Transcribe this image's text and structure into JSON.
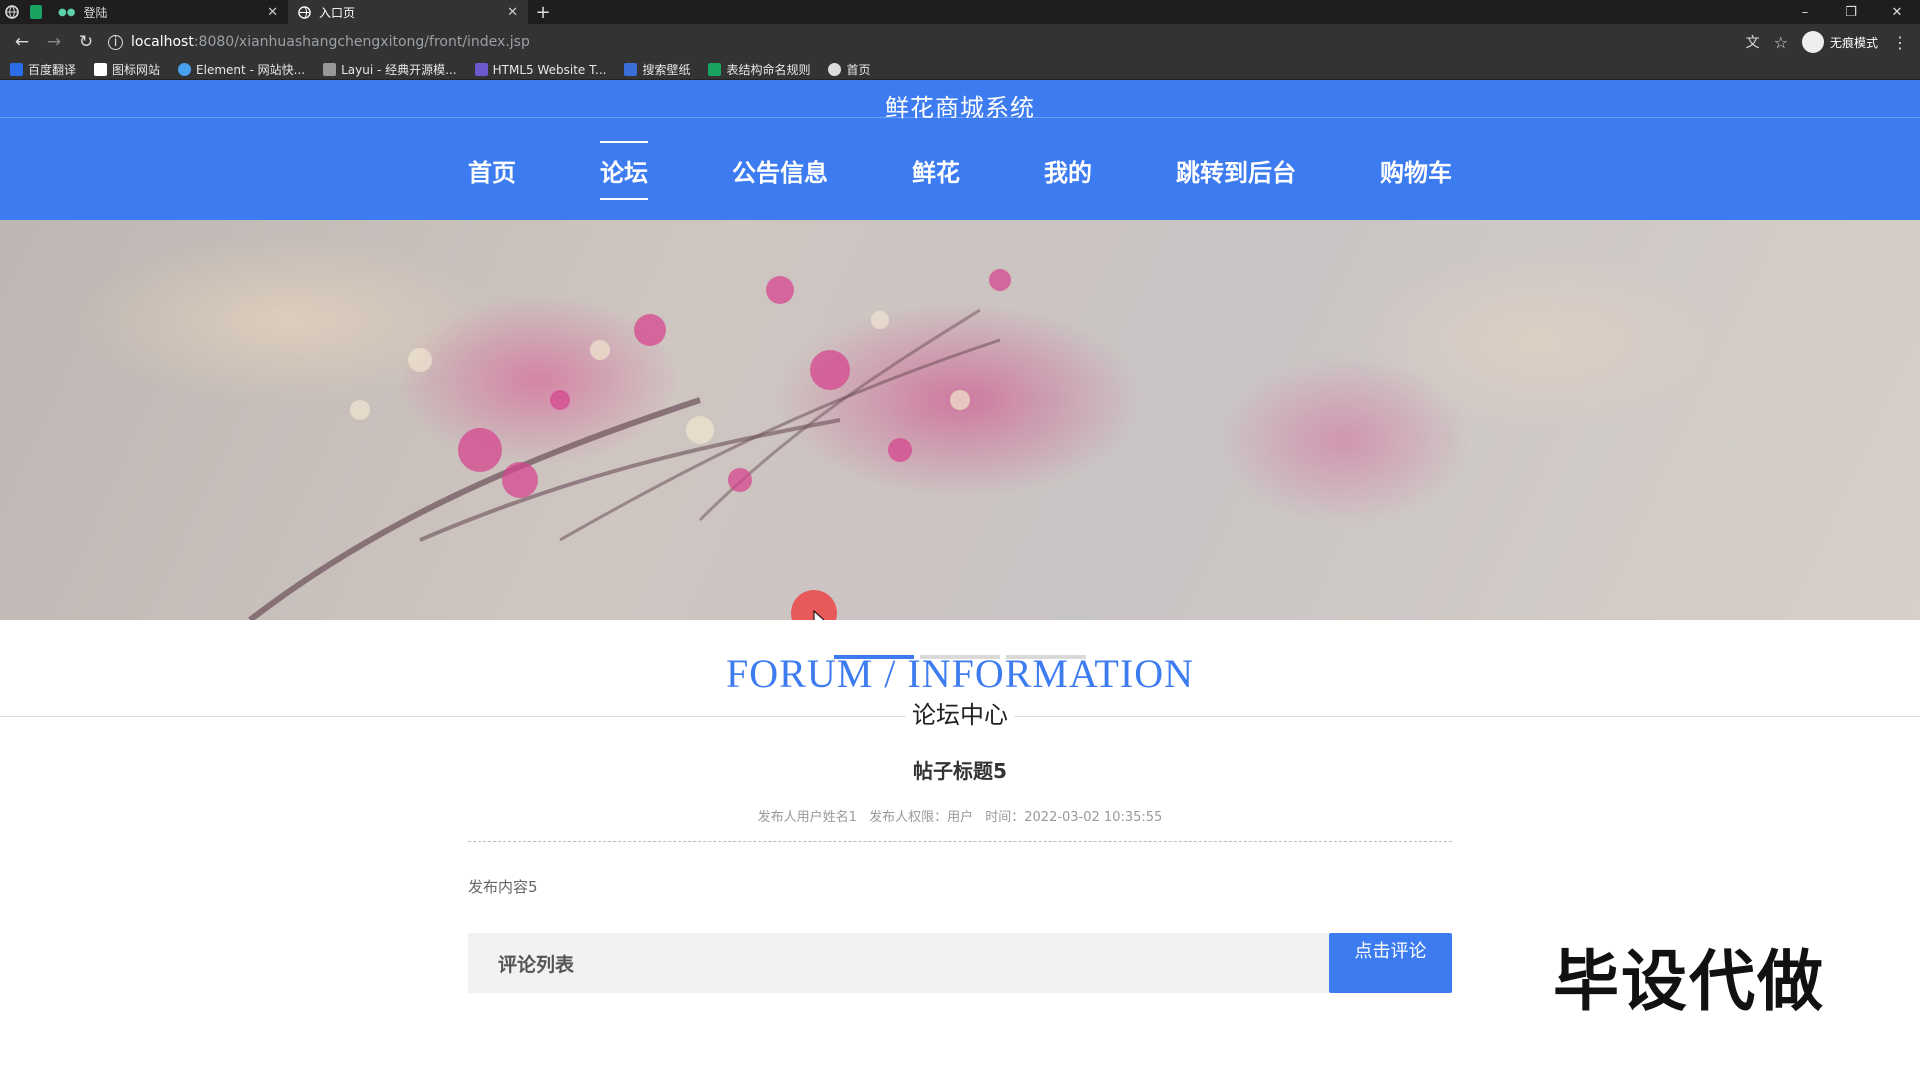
{
  "browser": {
    "tabs": [
      {
        "title": "登陆",
        "close": "✕"
      },
      {
        "title": "入口页",
        "close": "✕"
      }
    ],
    "new_tab": "+",
    "window_controls": {
      "minimize": "–",
      "restore": "❐",
      "close": "✕"
    },
    "address": {
      "host": "localhost",
      "path": ":8080/xianhuashangchengxitong/front/index.jsp"
    },
    "profile_label": "无痕模式",
    "bookmarks": [
      {
        "label": "百度翻译",
        "color": "#2b6de8"
      },
      {
        "label": "图标网站",
        "color": "#ffffff"
      },
      {
        "label": "Element - 网站快...",
        "color": "#4aa0f0"
      },
      {
        "label": "Layui - 经典开源模...",
        "color": "#999999"
      },
      {
        "label": "HTML5 Website T...",
        "color": "#6a5acd"
      },
      {
        "label": "搜索壁纸",
        "color": "#3b6fd8"
      },
      {
        "label": "表结构命名规则",
        "color": "#1aa260"
      },
      {
        "label": "首页",
        "color": "#dddddd"
      }
    ]
  },
  "site": {
    "title": "鲜花商城系统",
    "nav": [
      {
        "label": "首页",
        "active": false
      },
      {
        "label": "论坛",
        "active": true
      },
      {
        "label": "公告信息",
        "active": false
      },
      {
        "label": "鲜花",
        "active": false
      },
      {
        "label": "我的",
        "active": false
      },
      {
        "label": "跳转到后台",
        "active": false
      },
      {
        "label": "购物车",
        "active": false
      }
    ],
    "accent_color": "#3d7cf0"
  },
  "carousel": {
    "slide_count": 3,
    "active_index": 0
  },
  "forum": {
    "heading_en": "FORUM / INFORMATION",
    "heading_cn": "论坛中心",
    "post": {
      "title": "帖子标题5",
      "author": "发布人用户姓名1",
      "role": "发布人权限：用户",
      "time": "时间：2022-03-02 10:35:55",
      "content": "发布内容5"
    },
    "comments": {
      "title": "评论列表",
      "button": "点击评论"
    }
  },
  "watermark": "毕设代做"
}
